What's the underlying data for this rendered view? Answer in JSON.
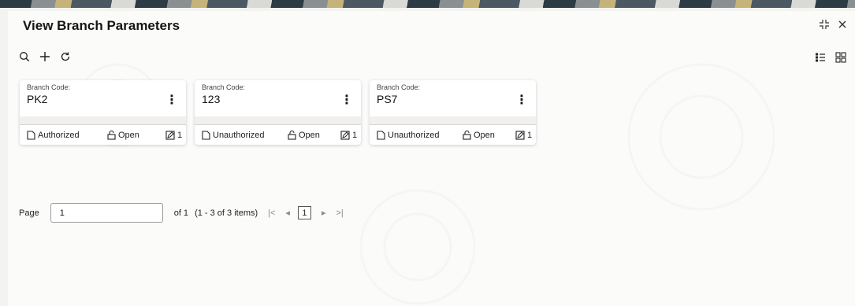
{
  "window": {
    "title": "View Branch Parameters"
  },
  "toolbar": {
    "icons": [
      "search-icon",
      "add-icon",
      "refresh-icon"
    ],
    "view_icons": [
      "list-view-icon",
      "grid-view-icon"
    ]
  },
  "cards": [
    {
      "label": "Branch Code:",
      "value": "PK2",
      "auth_status": "Authorized",
      "record_status": "Open",
      "mod_count": "1"
    },
    {
      "label": "Branch Code:",
      "value": "123",
      "auth_status": "Unauthorized",
      "record_status": "Open",
      "mod_count": "1"
    },
    {
      "label": "Branch Code:",
      "value": "PS7",
      "auth_status": "Unauthorized",
      "record_status": "Open",
      "mod_count": "1"
    }
  ],
  "pager": {
    "label": "Page",
    "value": "1",
    "of_text": "of 1",
    "items_text": "(1 - 3 of 3 items)",
    "first": "|<",
    "prev": "◂",
    "current": "1",
    "next": "▸",
    "last": ">|"
  }
}
